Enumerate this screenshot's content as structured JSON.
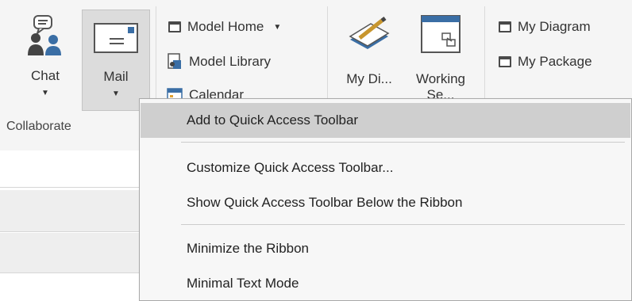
{
  "ribbon": {
    "chat_label": "Chat",
    "mail_label": "Mail",
    "model_home_label": "Model Home",
    "model_library_label": "Model Library",
    "calendar_label": "Calendar",
    "my_diagrams_label": "My Di...",
    "working_sets_label": "Working Se...",
    "my_diagram_label": "My Diagram",
    "my_package_label": "My Package",
    "group_label": "Collaborate",
    "icons": {
      "chat": "chat-people-icon",
      "mail": "mail-envelope-icon",
      "model_home": "window-icon",
      "model_library": "library-icon",
      "calendar": "calendar-icon",
      "my_diagrams": "pencil-icon",
      "working_sets": "working-set-icon",
      "my_diagram": "window-icon",
      "my_package": "window-icon"
    }
  },
  "context_menu": {
    "items": [
      {
        "label": "Add to Quick Access Toolbar",
        "highlighted": true
      },
      {
        "label": "Customize Quick Access Toolbar..."
      },
      {
        "label": "Show Quick Access Toolbar Below the Ribbon"
      },
      {
        "label": "Minimize the Ribbon"
      },
      {
        "label": "Minimal Text Mode"
      }
    ]
  },
  "colors": {
    "ribbon_bg": "#f5f5f5",
    "menu_bg": "#f7f7f7",
    "menu_highlight": "#cfcfcf",
    "icon_blue": "#3a6ea5"
  }
}
